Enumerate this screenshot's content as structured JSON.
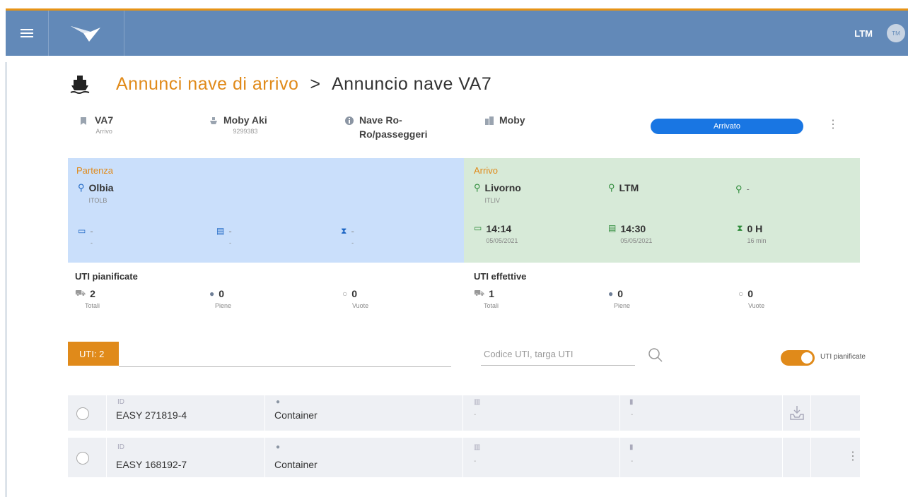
{
  "header": {
    "user_code": "LTM",
    "avatar_initials": "TM"
  },
  "breadcrumb": {
    "parent": "Annunci nave di arrivo",
    "separator": ">",
    "current": "Annuncio nave VA7"
  },
  "vessel_info": {
    "voyage": {
      "value": "VA7",
      "sub": "Arrivo"
    },
    "ship": {
      "value": "Moby Aki",
      "sub": "9299383"
    },
    "type": {
      "line1": "Nave Ro-",
      "line2": "Ro/passeggeri"
    },
    "company": {
      "value": "Moby"
    },
    "status": "Arrivato"
  },
  "departure": {
    "label": "Partenza",
    "location": {
      "name": "Olbia",
      "code": "ITOLB"
    },
    "times": [
      {
        "value": "-",
        "sub": "-"
      },
      {
        "value": "-",
        "sub": "-"
      },
      {
        "value": "-",
        "sub": "-"
      }
    ]
  },
  "arrival": {
    "label": "Arrivo",
    "location": {
      "name": "Livorno",
      "code": "ITLIV"
    },
    "terminal": "LTM",
    "berth": "-",
    "times": [
      {
        "value": "14:14",
        "sub": "05/05/2021"
      },
      {
        "value": "14:30",
        "sub": "05/05/2021"
      },
      {
        "value": "0 H",
        "sub": "16 min"
      }
    ]
  },
  "uti_planned": {
    "title": "UTI pianificate",
    "stats": [
      {
        "value": "2",
        "label": "Totali"
      },
      {
        "value": "0",
        "label": "Piene"
      },
      {
        "value": "0",
        "label": "Vuote"
      }
    ]
  },
  "uti_actual": {
    "title": "UTI effettive",
    "stats": [
      {
        "value": "1",
        "label": "Totali"
      },
      {
        "value": "0",
        "label": "Piene"
      },
      {
        "value": "0",
        "label": "Vuote"
      }
    ]
  },
  "tab": {
    "label": "UTI: 2"
  },
  "search": {
    "placeholder": "Codice UTI, targa UTI"
  },
  "toggle": {
    "label": "UTI pianificate",
    "on": true
  },
  "rows": [
    {
      "id_label": "ID",
      "id": "EASY 271819-4",
      "type": "Container",
      "col3": "-",
      "col4": "-"
    },
    {
      "id_label": "ID",
      "id": "EASY 168192-7",
      "type": "Container",
      "col3": "-",
      "col4": "-"
    }
  ],
  "colors": {
    "accent": "#e08a1a",
    "topbar": "#6289b8",
    "status": "#1976e3",
    "departure_bg": "#cadffb",
    "arrival_bg": "#d7ead8"
  }
}
